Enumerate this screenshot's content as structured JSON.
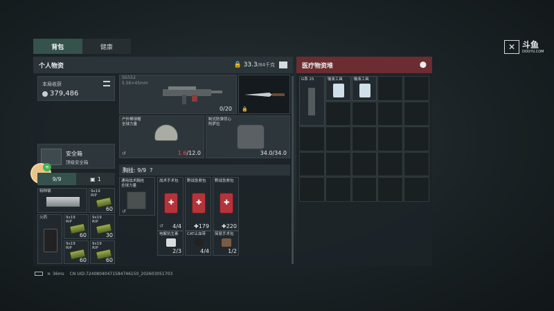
{
  "tabs": [
    "背包",
    "健康"
  ],
  "personal": {
    "title": "个人物资",
    "weight": "33.3",
    "weight_max": "/84千克",
    "earnings_label": "本局收获",
    "earnings_value": "379,486",
    "safebox_title": "安全箱",
    "safebox_sub": "顶级安全箱",
    "count_a": "9/9",
    "count_b": "1"
  },
  "weapon": {
    "name": "SG552",
    "sub": "5.56×45mm",
    "ammo": "0/20"
  },
  "helmet": {
    "name": "户外棒球帽",
    "sub": "全球力量",
    "dur_cur": "1.6",
    "dur_max": "/12.0"
  },
  "armor": {
    "name": "制式防弹背心",
    "sub": "阿萨拉",
    "dur": "34.0/34.0"
  },
  "chest_rig": {
    "label": "胸挂: 9/9",
    "q": "?",
    "items": [
      {
        "name": "通用战术胸挂",
        "sub": "全球力量",
        "count": ""
      },
      {
        "name": "战术手术包",
        "sub": "",
        "count": "4/4"
      },
      {
        "name": "野战急救包",
        "sub": "",
        "count": "179"
      },
      {
        "name": "野战急救包",
        "sub": "",
        "count": "220"
      },
      {
        "name": "电解抗生素",
        "sub": "",
        "count": "2/3"
      },
      {
        "name": "CAT止血带",
        "sub": "",
        "count": "4/4"
      },
      {
        "name": "简易手术包",
        "sub": "",
        "count": "1/2"
      }
    ]
  },
  "bag_items": [
    {
      "name": "特种钢",
      "count": ""
    },
    {
      "name": "9x19",
      "sub": "RIP",
      "count": "60"
    },
    {
      "name": "火药",
      "count": ""
    },
    {
      "name": "9x19",
      "sub": "RIP",
      "count": "60"
    },
    {
      "name": "9x19",
      "sub": "RIP",
      "count": "30"
    },
    {
      "name": "9x19",
      "sub": "RIP",
      "count": "60"
    },
    {
      "name": "9x19",
      "sub": "RIP",
      "count": "60"
    }
  ],
  "medical": {
    "title": "医疗物资堆",
    "items": [
      {
        "name": "G系 25"
      },
      {
        "name": "输液工具"
      },
      {
        "name": "输液工具"
      }
    ]
  },
  "status": {
    "ping": "36ms",
    "uid": "CN UID:7240804047158474615​0_202603051703"
  },
  "watermark": {
    "brand": "斗鱼",
    "url": "DOUYU.COM"
  }
}
